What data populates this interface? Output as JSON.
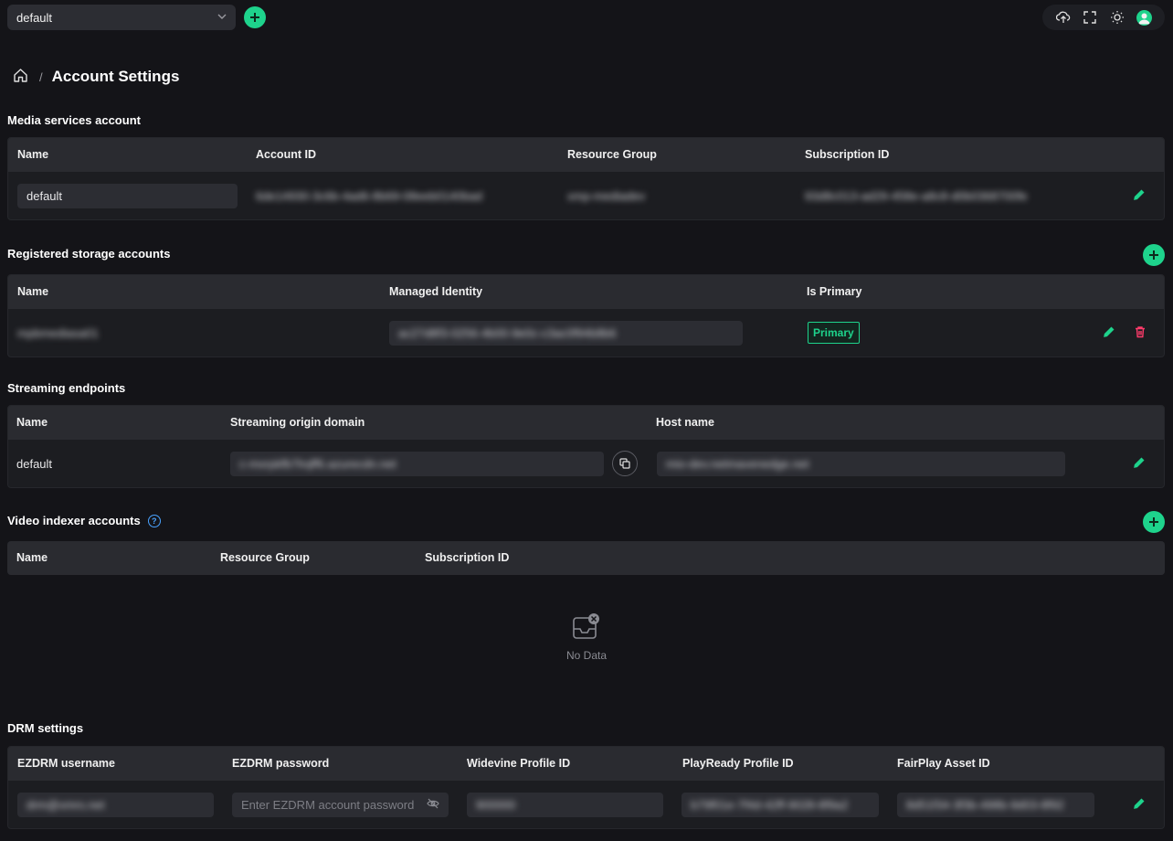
{
  "topbar": {
    "account_select_value": "default",
    "icons": [
      "upload-icon",
      "fullscreen-icon",
      "theme-sun-icon",
      "user-avatar-icon"
    ]
  },
  "breadcrumb": {
    "title": "Account Settings",
    "separator": "/"
  },
  "media_services": {
    "title": "Media services account",
    "columns": [
      "Name",
      "Account ID",
      "Resource Group",
      "Subscription ID"
    ],
    "row": {
      "name": "default",
      "account_id": "6de14930-3c6b-4ad6-8b69-08eeb0140bad",
      "resource_group": "xmp-mediadev",
      "subscription_id": "93d8c013-ad29-458e-a8c8-d0b0368700fe"
    }
  },
  "storage": {
    "title": "Registered storage accounts",
    "columns": [
      "Name",
      "Managed Identity",
      "Is Primary"
    ],
    "row": {
      "name": "mpbmediasa01",
      "managed_identity": "ac27d8f3-0256-4b00-9e0c-c3ac0f94b8b6",
      "is_primary": "Primary"
    }
  },
  "streaming": {
    "title": "Streaming endpoints",
    "columns": [
      "Name",
      "Streaming origin domain",
      "Host name"
    ],
    "row": {
      "name": "default",
      "origin_domain": "c-mxrpkfb7lrqff6.azurecdn.net",
      "host_name": "mio-dev.netmavenedge.net"
    }
  },
  "video_indexer": {
    "title": "Video indexer accounts",
    "columns": [
      "Name",
      "Resource Group",
      "Subscription ID"
    ],
    "empty_text": "No Data"
  },
  "drm": {
    "title": "DRM settings",
    "columns": [
      "EZDRM username",
      "EZDRM password",
      "Widevine Profile ID",
      "PlayReady Profile ID",
      "FairPlay Asset ID"
    ],
    "row": {
      "username": "drm@xmrs.net",
      "password_placeholder": "Enter EZDRM account password",
      "widevine_profile_id": "900000",
      "playready_profile_id": "b79f01e-7f4d-42ff-9028-8f9a2",
      "fairplay_asset_id": "8d51f34-3f3b-498b-9d03-8f92"
    }
  },
  "colors": {
    "accent": "#1ed38c",
    "danger": "#ff3b6b",
    "background": "#141418",
    "header": "#2a2b30"
  }
}
